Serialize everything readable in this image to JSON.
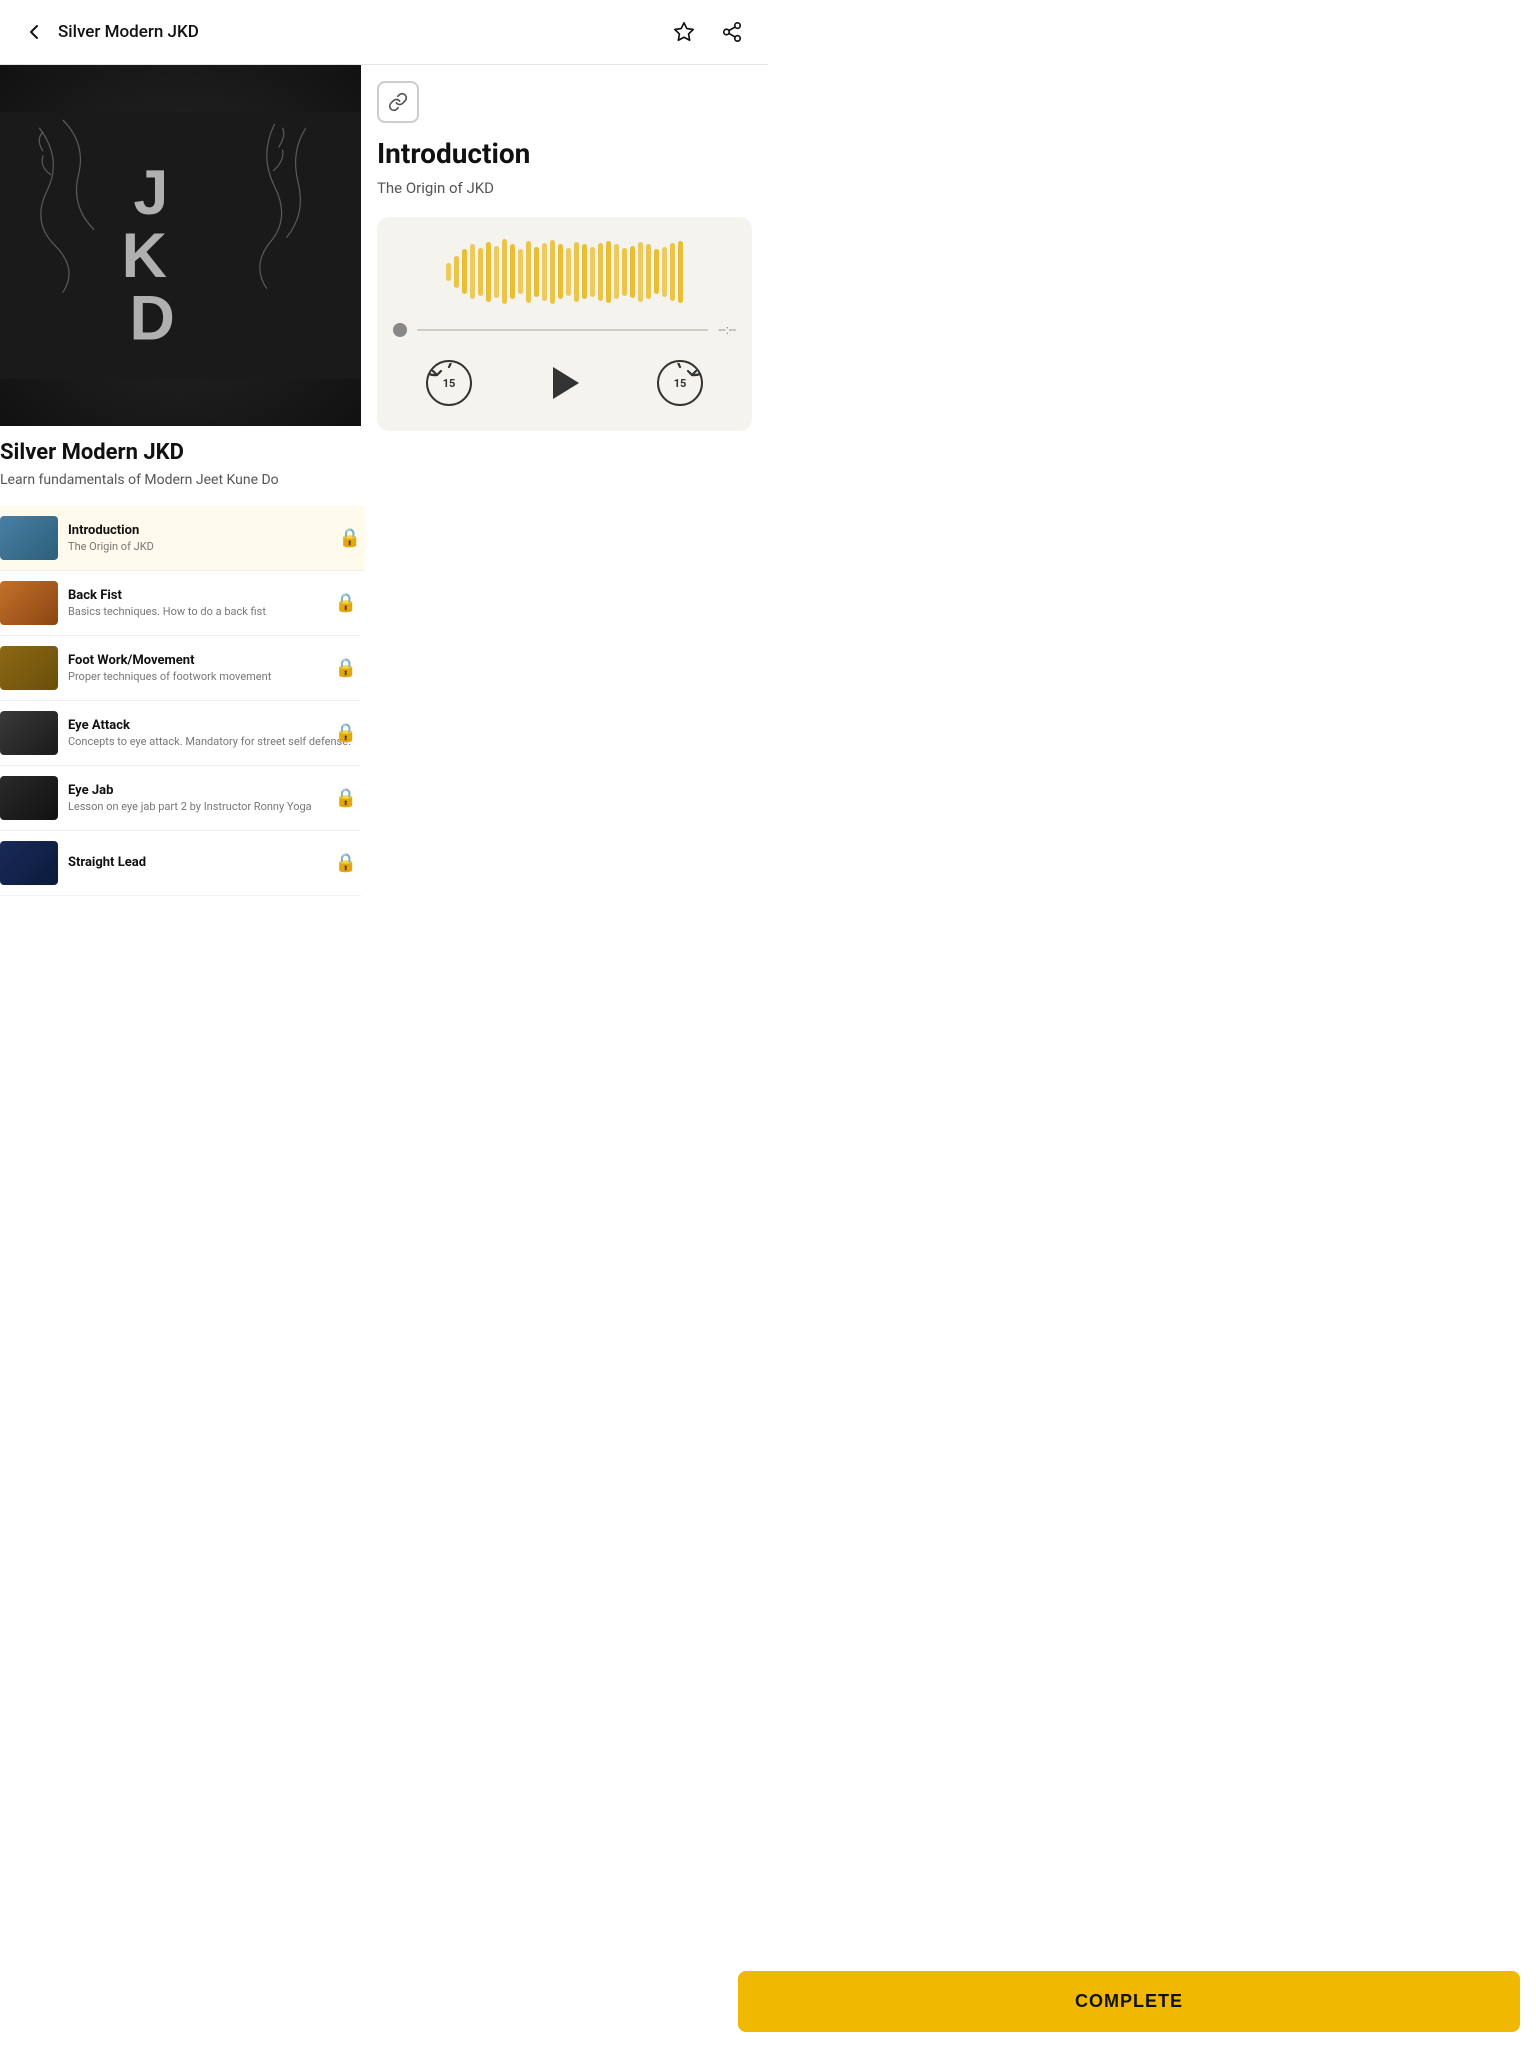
{
  "header": {
    "back_label": "Silver Modern JKD",
    "title": "Silver Modern JKD"
  },
  "course": {
    "name": "Silver Modern JKD",
    "description": "Learn fundamentals of Modern Jeet Kune Do",
    "image_alt": "JKD Logo"
  },
  "detail": {
    "link_icon": "🔗",
    "title": "Introduction",
    "subtitle": "The Origin of JKD"
  },
  "player": {
    "progress_time": "--:--",
    "rewind_label": "15",
    "forward_label": "15"
  },
  "lessons": [
    {
      "title": "Introduction",
      "subtitle": "The Origin of JKD",
      "thumb_class": "thumb-blue",
      "locked": true,
      "active": true
    },
    {
      "title": "Back Fist",
      "subtitle": "Basics techniques. How to do a back fist",
      "thumb_class": "thumb-orange",
      "locked": true,
      "active": false
    },
    {
      "title": "Foot Work/Movement",
      "subtitle": "Proper techniques of footwork movement",
      "thumb_class": "thumb-brown",
      "locked": true,
      "active": false
    },
    {
      "title": "Eye Attack",
      "subtitle": "Concepts to eye attack. Mandatory for street self defense.",
      "thumb_class": "thumb-dark",
      "locked": true,
      "active": false
    },
    {
      "title": "Eye Jab",
      "subtitle": "Lesson on eye jab part 2 by Instructor Ronny Yoga",
      "thumb_class": "thumb-darkgray",
      "locked": true,
      "active": false
    },
    {
      "title": "Straight Lead",
      "subtitle": "",
      "thumb_class": "thumb-navy",
      "locked": true,
      "active": false
    }
  ],
  "buttons": {
    "complete_label": "COMPLETE"
  },
  "icons": {
    "back": "‹",
    "star": "☆",
    "link": "🔗",
    "lock": "🔒"
  },
  "waveform": {
    "bars": [
      18,
      32,
      45,
      55,
      48,
      60,
      52,
      65,
      55,
      45,
      62,
      50,
      58,
      64,
      55,
      48,
      60,
      55,
      50,
      58,
      62,
      55,
      48,
      52,
      60,
      55,
      45,
      50,
      58,
      62
    ]
  }
}
